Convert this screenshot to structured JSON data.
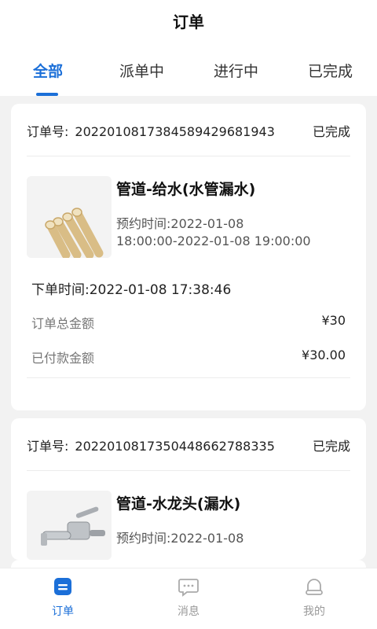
{
  "header": {
    "title": "订单",
    "tabs": [
      {
        "label": "全部",
        "active": true
      },
      {
        "label": "派单中",
        "active": false
      },
      {
        "label": "进行中",
        "active": false
      },
      {
        "label": "已完成",
        "active": false
      }
    ]
  },
  "orders": [
    {
      "order_no_label": "订单号:",
      "order_no": "20220108173845894296819​43",
      "status": "已完成",
      "item_name": "管道-给水(水管漏水)",
      "appointment_line1": "预约时间:2022-01-08",
      "appointment_line2": "18:00:00-2022-01-08 19:00:00",
      "placed_time": "下单时间:2022-01-08 17:38:46",
      "total_label": "订单总金额",
      "total_value": "¥30",
      "paid_label": "已付款金额",
      "paid_value": "¥30.00"
    },
    {
      "order_no_label": "订单号:",
      "order_no": "20220108173504486627883​35",
      "status": "已完成",
      "item_name": "管道-水龙头(漏水)",
      "appointment_line1": "预约时间:2022-01-08"
    }
  ],
  "bottom_nav": [
    {
      "label": "订单",
      "icon": "order-icon",
      "active": true
    },
    {
      "label": "消息",
      "icon": "message-icon",
      "active": false
    },
    {
      "label": "我的",
      "icon": "profile-icon",
      "active": false
    }
  ],
  "colors": {
    "accent": "#1b6fd8",
    "background": "#f2f2f2"
  }
}
